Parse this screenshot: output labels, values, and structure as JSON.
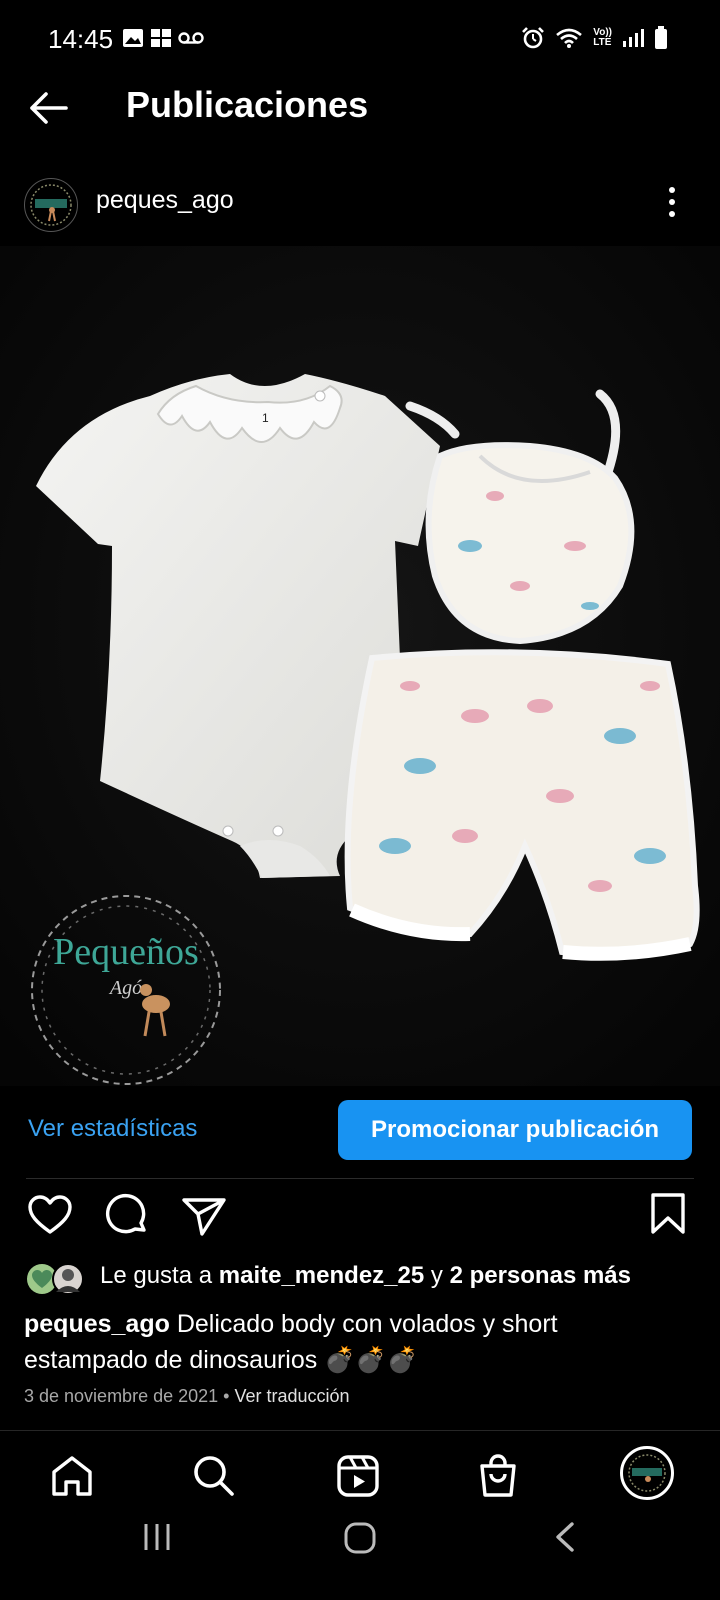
{
  "status_bar": {
    "time": "14:45",
    "network": "LTE",
    "volte": "Vo))"
  },
  "header": {
    "title": "Publicaciones"
  },
  "post": {
    "username": "peques_ago",
    "image_watermark": "Pequeños Agó"
  },
  "actions": {
    "stats_label": "Ver estadísticas",
    "promote_label": "Promocionar publicación"
  },
  "likes": {
    "prefix": "Le gusta a",
    "user": "maite_mendez_25",
    "connector": "y",
    "others": "2 personas más"
  },
  "caption": {
    "username": "peques_ago",
    "text": "Delicado body con volados y short estampado de dinosaurios 💣💣💣"
  },
  "meta": {
    "date": "3 de noviembre de 2021",
    "separator": "•",
    "translate": "Ver traducción"
  },
  "colors": {
    "accent": "#1893f2",
    "link": "#3aa2f2",
    "background": "#000000"
  }
}
